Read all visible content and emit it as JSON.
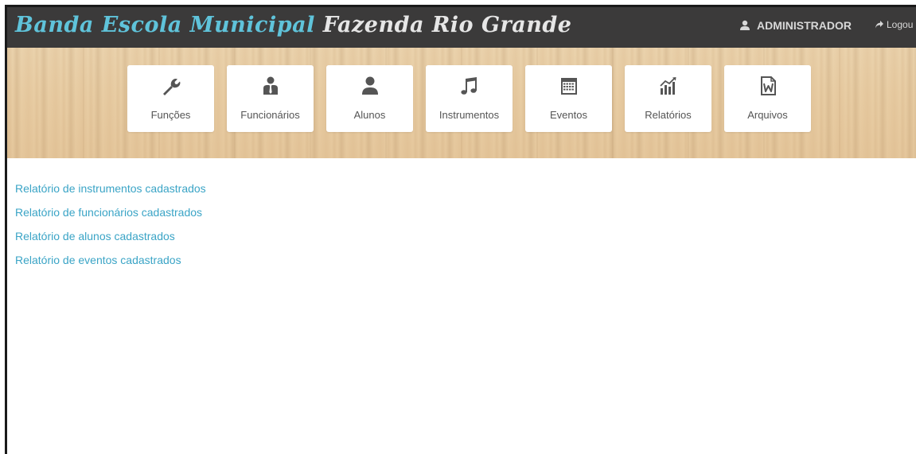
{
  "header": {
    "brand_part1": "Banda Escola Municipal",
    "brand_part2": "Fazenda Rio Grande",
    "user_name": "ADMINISTRADOR",
    "logout_label": "Logou"
  },
  "tiles": [
    {
      "label": "Funções",
      "icon": "wrench-icon"
    },
    {
      "label": "Funcionários",
      "icon": "employee-icon"
    },
    {
      "label": "Alunos",
      "icon": "user-icon"
    },
    {
      "label": "Instrumentos",
      "icon": "music-note-icon"
    },
    {
      "label": "Eventos",
      "icon": "calendar-icon"
    },
    {
      "label": "Relatórios",
      "icon": "chart-icon"
    },
    {
      "label": "Arquivos",
      "icon": "word-document-icon"
    }
  ],
  "reports": [
    "Relatório de instrumentos cadastrados",
    "Relatório de funcionários cadastrados",
    "Relatório de alunos cadastrados",
    "Relatório de eventos cadastrados"
  ],
  "colors": {
    "navbar": "#3b3a3a",
    "brand_accent": "#5fc3da",
    "link": "#3aa4c6",
    "icon": "#555555"
  }
}
